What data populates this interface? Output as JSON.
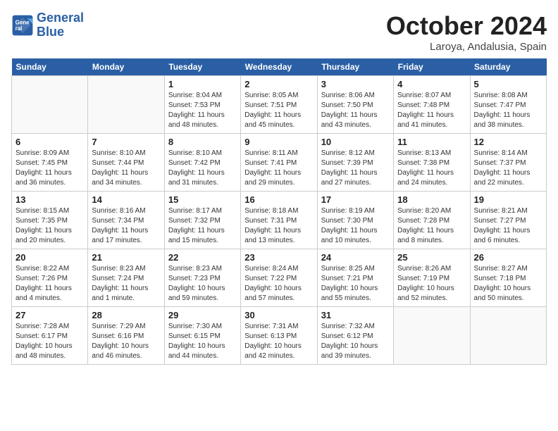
{
  "logo": {
    "line1": "General",
    "line2": "Blue"
  },
  "title": "October 2024",
  "location": "Laroya, Andalusia, Spain",
  "weekdays": [
    "Sunday",
    "Monday",
    "Tuesday",
    "Wednesday",
    "Thursday",
    "Friday",
    "Saturday"
  ],
  "weeks": [
    [
      {
        "day": "",
        "info": ""
      },
      {
        "day": "",
        "info": ""
      },
      {
        "day": "1",
        "info": "Sunrise: 8:04 AM\nSunset: 7:53 PM\nDaylight: 11 hours and 48 minutes."
      },
      {
        "day": "2",
        "info": "Sunrise: 8:05 AM\nSunset: 7:51 PM\nDaylight: 11 hours and 45 minutes."
      },
      {
        "day": "3",
        "info": "Sunrise: 8:06 AM\nSunset: 7:50 PM\nDaylight: 11 hours and 43 minutes."
      },
      {
        "day": "4",
        "info": "Sunrise: 8:07 AM\nSunset: 7:48 PM\nDaylight: 11 hours and 41 minutes."
      },
      {
        "day": "5",
        "info": "Sunrise: 8:08 AM\nSunset: 7:47 PM\nDaylight: 11 hours and 38 minutes."
      }
    ],
    [
      {
        "day": "6",
        "info": "Sunrise: 8:09 AM\nSunset: 7:45 PM\nDaylight: 11 hours and 36 minutes."
      },
      {
        "day": "7",
        "info": "Sunrise: 8:10 AM\nSunset: 7:44 PM\nDaylight: 11 hours and 34 minutes."
      },
      {
        "day": "8",
        "info": "Sunrise: 8:10 AM\nSunset: 7:42 PM\nDaylight: 11 hours and 31 minutes."
      },
      {
        "day": "9",
        "info": "Sunrise: 8:11 AM\nSunset: 7:41 PM\nDaylight: 11 hours and 29 minutes."
      },
      {
        "day": "10",
        "info": "Sunrise: 8:12 AM\nSunset: 7:39 PM\nDaylight: 11 hours and 27 minutes."
      },
      {
        "day": "11",
        "info": "Sunrise: 8:13 AM\nSunset: 7:38 PM\nDaylight: 11 hours and 24 minutes."
      },
      {
        "day": "12",
        "info": "Sunrise: 8:14 AM\nSunset: 7:37 PM\nDaylight: 11 hours and 22 minutes."
      }
    ],
    [
      {
        "day": "13",
        "info": "Sunrise: 8:15 AM\nSunset: 7:35 PM\nDaylight: 11 hours and 20 minutes."
      },
      {
        "day": "14",
        "info": "Sunrise: 8:16 AM\nSunset: 7:34 PM\nDaylight: 11 hours and 17 minutes."
      },
      {
        "day": "15",
        "info": "Sunrise: 8:17 AM\nSunset: 7:32 PM\nDaylight: 11 hours and 15 minutes."
      },
      {
        "day": "16",
        "info": "Sunrise: 8:18 AM\nSunset: 7:31 PM\nDaylight: 11 hours and 13 minutes."
      },
      {
        "day": "17",
        "info": "Sunrise: 8:19 AM\nSunset: 7:30 PM\nDaylight: 11 hours and 10 minutes."
      },
      {
        "day": "18",
        "info": "Sunrise: 8:20 AM\nSunset: 7:28 PM\nDaylight: 11 hours and 8 minutes."
      },
      {
        "day": "19",
        "info": "Sunrise: 8:21 AM\nSunset: 7:27 PM\nDaylight: 11 hours and 6 minutes."
      }
    ],
    [
      {
        "day": "20",
        "info": "Sunrise: 8:22 AM\nSunset: 7:26 PM\nDaylight: 11 hours and 4 minutes."
      },
      {
        "day": "21",
        "info": "Sunrise: 8:23 AM\nSunset: 7:24 PM\nDaylight: 11 hours and 1 minute."
      },
      {
        "day": "22",
        "info": "Sunrise: 8:23 AM\nSunset: 7:23 PM\nDaylight: 10 hours and 59 minutes."
      },
      {
        "day": "23",
        "info": "Sunrise: 8:24 AM\nSunset: 7:22 PM\nDaylight: 10 hours and 57 minutes."
      },
      {
        "day": "24",
        "info": "Sunrise: 8:25 AM\nSunset: 7:21 PM\nDaylight: 10 hours and 55 minutes."
      },
      {
        "day": "25",
        "info": "Sunrise: 8:26 AM\nSunset: 7:19 PM\nDaylight: 10 hours and 52 minutes."
      },
      {
        "day": "26",
        "info": "Sunrise: 8:27 AM\nSunset: 7:18 PM\nDaylight: 10 hours and 50 minutes."
      }
    ],
    [
      {
        "day": "27",
        "info": "Sunrise: 7:28 AM\nSunset: 6:17 PM\nDaylight: 10 hours and 48 minutes."
      },
      {
        "day": "28",
        "info": "Sunrise: 7:29 AM\nSunset: 6:16 PM\nDaylight: 10 hours and 46 minutes."
      },
      {
        "day": "29",
        "info": "Sunrise: 7:30 AM\nSunset: 6:15 PM\nDaylight: 10 hours and 44 minutes."
      },
      {
        "day": "30",
        "info": "Sunrise: 7:31 AM\nSunset: 6:13 PM\nDaylight: 10 hours and 42 minutes."
      },
      {
        "day": "31",
        "info": "Sunrise: 7:32 AM\nSunset: 6:12 PM\nDaylight: 10 hours and 39 minutes."
      },
      {
        "day": "",
        "info": ""
      },
      {
        "day": "",
        "info": ""
      }
    ]
  ]
}
